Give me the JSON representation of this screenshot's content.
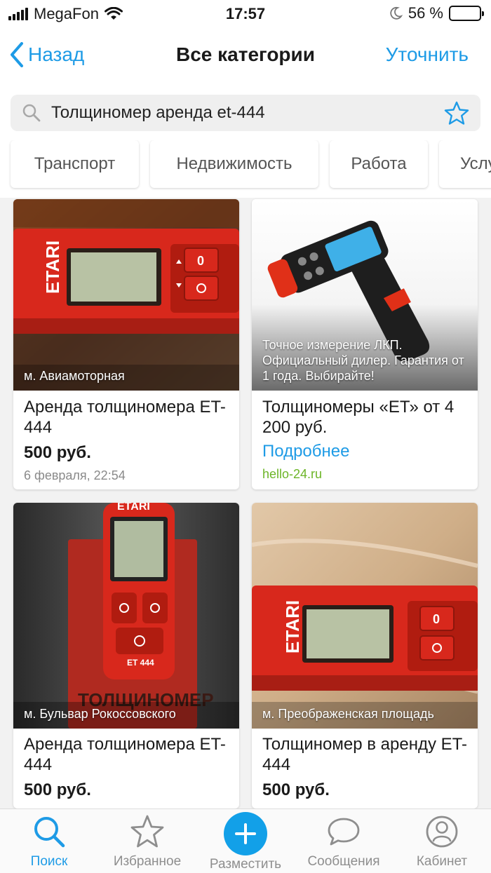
{
  "status_bar": {
    "carrier": "MegaFon",
    "time": "17:57",
    "battery": "56 %",
    "battery_level": 0.56
  },
  "nav": {
    "back_label": "Назад",
    "title": "Все категории",
    "refine_label": "Уточнить"
  },
  "search": {
    "query": "Толщиномер аренда et-444",
    "icon": "search-icon",
    "favorite_icon": "star-icon"
  },
  "categories": [
    "Транспорт",
    "Недвижимость",
    "Работа",
    "Услуги"
  ],
  "listings": [
    {
      "location": "м. Авиамоторная",
      "title": "Аренда толщиномера ET-444",
      "price": "500 руб.",
      "date": "6 февраля, 22:54"
    },
    {
      "ad_caption": "Точное измерение ЛКП. Официальный дилер. Гарантия от 1 года. Выбирайте!",
      "title": "Толщиномеры «ЕТ» от 4 200 руб.",
      "more": "Подробнее",
      "site": "hello-24.ru"
    },
    {
      "location": "м. Бульвар Рокоссовского",
      "title": "Аренда толщиномера ET-444",
      "price": "500 руб."
    },
    {
      "location": "м. Преображенская площадь",
      "title": "Толщиномер в аренду ET-444",
      "price": "500 руб."
    }
  ],
  "tabs": [
    {
      "label": "Поиск",
      "icon": "search-icon",
      "active": true
    },
    {
      "label": "Избранное",
      "icon": "star-icon",
      "active": false
    },
    {
      "label": "Разместить",
      "icon": "plus-icon",
      "active": false
    },
    {
      "label": "Сообщения",
      "icon": "chat-bubble-icon",
      "active": false
    },
    {
      "label": "Кабинет",
      "icon": "profile-icon",
      "active": false
    }
  ],
  "colors": {
    "accent": "#1e9be6",
    "site_green": "#6cb527",
    "device_red": "#d8281c"
  }
}
